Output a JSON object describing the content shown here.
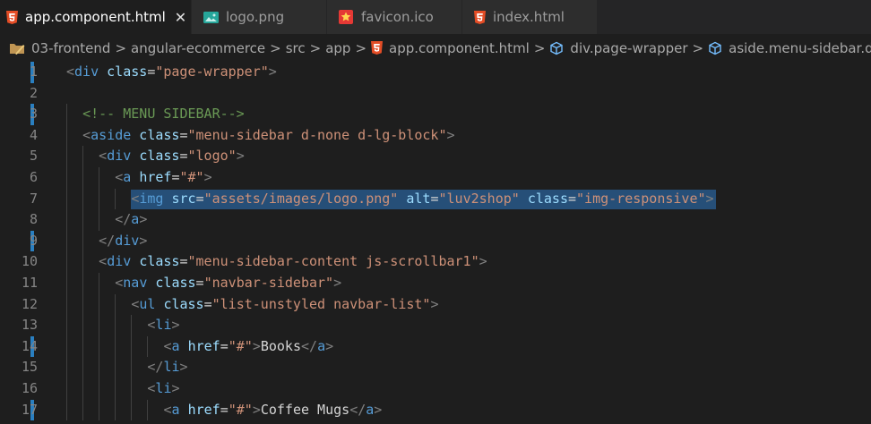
{
  "tabs": [
    {
      "label": "app.component.html",
      "icon": "html5-icon",
      "active": true,
      "close": "✕"
    },
    {
      "label": "logo.png",
      "icon": "image-icon",
      "active": false
    },
    {
      "label": "favicon.ico",
      "icon": "star-icon",
      "active": false
    },
    {
      "label": "index.html",
      "icon": "html5-icon",
      "active": false
    }
  ],
  "breadcrumb": {
    "items": [
      "03-frontend",
      "angular-ecommerce",
      "src",
      "app",
      "app.component.html",
      "div.page-wrapper",
      "aside.menu-sidebar.d-no"
    ],
    "separator": ">"
  },
  "editor": {
    "lines": [
      {
        "num": "1",
        "modified": true,
        "tokens": [
          [
            "p",
            "<"
          ],
          [
            "tag",
            "div"
          ],
          [
            "t",
            " "
          ],
          [
            "attr",
            "class"
          ],
          [
            "t",
            "="
          ],
          [
            "str",
            "\"page-wrapper\""
          ],
          [
            "p",
            ">"
          ]
        ]
      },
      {
        "num": "2",
        "modified": false,
        "tokens": []
      },
      {
        "num": "3",
        "modified": true,
        "tokens": [
          [
            "c",
            "<!-- MENU SIDEBAR-->"
          ]
        ]
      },
      {
        "num": "4",
        "modified": false,
        "tokens": [
          [
            "p",
            "<"
          ],
          [
            "tag",
            "aside"
          ],
          [
            "t",
            " "
          ],
          [
            "attr",
            "class"
          ],
          [
            "t",
            "="
          ],
          [
            "str",
            "\"menu-sidebar d-none d-lg-block\""
          ],
          [
            "p",
            ">"
          ]
        ]
      },
      {
        "num": "5",
        "modified": false,
        "tokens": [
          [
            "p",
            "<"
          ],
          [
            "tag",
            "div"
          ],
          [
            "t",
            " "
          ],
          [
            "attr",
            "class"
          ],
          [
            "t",
            "="
          ],
          [
            "str",
            "\"logo\""
          ],
          [
            "p",
            ">"
          ]
        ]
      },
      {
        "num": "6",
        "modified": false,
        "tokens": [
          [
            "p",
            "<"
          ],
          [
            "tag",
            "a"
          ],
          [
            "t",
            " "
          ],
          [
            "attr",
            "href"
          ],
          [
            "t",
            "="
          ],
          [
            "str",
            "\"#\""
          ],
          [
            "p",
            ">"
          ]
        ]
      },
      {
        "num": "7",
        "modified": false,
        "tokens": [
          [
            "p",
            "<"
          ],
          [
            "tag",
            "img"
          ],
          [
            "t",
            " "
          ],
          [
            "attr",
            "src"
          ],
          [
            "t",
            "="
          ],
          [
            "str",
            "\"assets/images/logo.png\""
          ],
          [
            "t",
            " "
          ],
          [
            "attr",
            "alt"
          ],
          [
            "t",
            "="
          ],
          [
            "str",
            "\"luv2shop\""
          ],
          [
            "t",
            " "
          ],
          [
            "attr",
            "class"
          ],
          [
            "t",
            "="
          ],
          [
            "str",
            "\"img-responsive\""
          ],
          [
            "p",
            ">"
          ]
        ]
      },
      {
        "num": "8",
        "modified": false,
        "tokens": [
          [
            "p",
            "</"
          ],
          [
            "tag",
            "a"
          ],
          [
            "p",
            ">"
          ]
        ]
      },
      {
        "num": "9",
        "modified": true,
        "tokens": [
          [
            "p",
            "</"
          ],
          [
            "tag",
            "div"
          ],
          [
            "p",
            ">"
          ]
        ]
      },
      {
        "num": "10",
        "modified": false,
        "tokens": [
          [
            "p",
            "<"
          ],
          [
            "tag",
            "div"
          ],
          [
            "t",
            " "
          ],
          [
            "attr",
            "class"
          ],
          [
            "t",
            "="
          ],
          [
            "str",
            "\"menu-sidebar-content js-scrollbar1\""
          ],
          [
            "p",
            ">"
          ]
        ]
      },
      {
        "num": "11",
        "modified": false,
        "tokens": [
          [
            "p",
            "<"
          ],
          [
            "tag",
            "nav"
          ],
          [
            "t",
            " "
          ],
          [
            "attr",
            "class"
          ],
          [
            "t",
            "="
          ],
          [
            "str",
            "\"navbar-sidebar\""
          ],
          [
            "p",
            ">"
          ]
        ]
      },
      {
        "num": "12",
        "modified": false,
        "tokens": [
          [
            "p",
            "<"
          ],
          [
            "tag",
            "ul"
          ],
          [
            "t",
            " "
          ],
          [
            "attr",
            "class"
          ],
          [
            "t",
            "="
          ],
          [
            "str",
            "\"list-unstyled navbar-list\""
          ],
          [
            "p",
            ">"
          ]
        ]
      },
      {
        "num": "13",
        "modified": false,
        "tokens": [
          [
            "p",
            "<"
          ],
          [
            "tag",
            "li"
          ],
          [
            "p",
            ">"
          ]
        ]
      },
      {
        "num": "14",
        "modified": true,
        "tokens": [
          [
            "p",
            "<"
          ],
          [
            "tag",
            "a"
          ],
          [
            "t",
            " "
          ],
          [
            "attr",
            "href"
          ],
          [
            "t",
            "="
          ],
          [
            "str",
            "\"#\""
          ],
          [
            "p",
            ">"
          ],
          [
            "t",
            "Books"
          ],
          [
            "p",
            "</"
          ],
          [
            "tag",
            "a"
          ],
          [
            "p",
            ">"
          ]
        ]
      },
      {
        "num": "15",
        "modified": false,
        "tokens": [
          [
            "p",
            "</"
          ],
          [
            "tag",
            "li"
          ],
          [
            "p",
            ">"
          ]
        ]
      },
      {
        "num": "16",
        "modified": false,
        "tokens": [
          [
            "p",
            "<"
          ],
          [
            "tag",
            "li"
          ],
          [
            "p",
            ">"
          ]
        ]
      },
      {
        "num": "17",
        "modified": true,
        "tokens": [
          [
            "p",
            "<"
          ],
          [
            "tag",
            "a"
          ],
          [
            "t",
            " "
          ],
          [
            "attr",
            "href"
          ],
          [
            "t",
            "="
          ],
          [
            "str",
            "\"#\""
          ],
          [
            "p",
            ">"
          ],
          [
            "t",
            "Coffee Mugs"
          ],
          [
            "p",
            "</"
          ],
          [
            "tag",
            "a"
          ],
          [
            "p",
            ">"
          ]
        ]
      }
    ]
  }
}
